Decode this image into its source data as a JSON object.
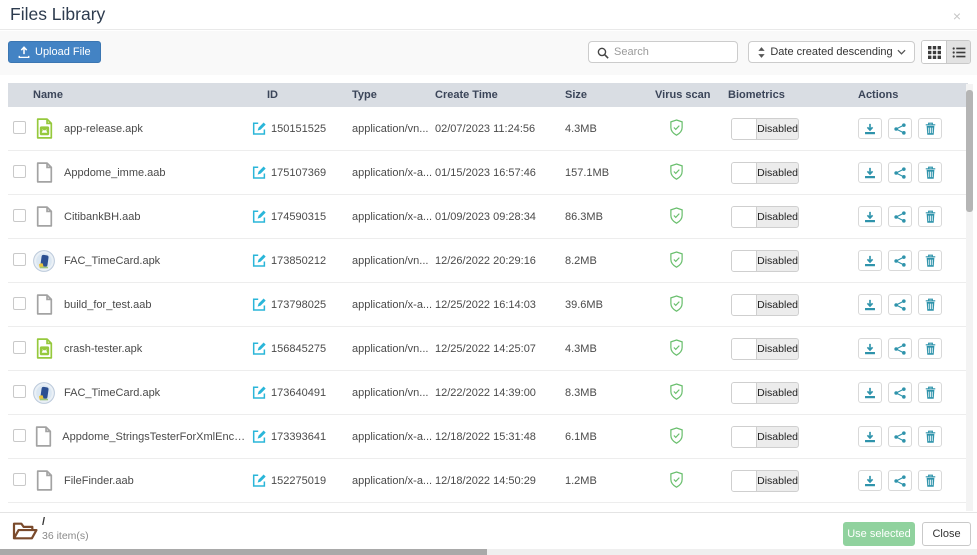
{
  "modal": {
    "title": "Files Library",
    "close_icon": "×"
  },
  "toolbar": {
    "upload_button": "Upload File",
    "search_placeholder": "Search",
    "sort_dropdown_value": "Date created descending"
  },
  "table": {
    "columns": {
      "name": "Name",
      "id": "ID",
      "type": "Type",
      "create_time": "Create Time",
      "size": "Size",
      "virus_scan": "Virus scan",
      "biometrics": "Biometrics",
      "actions": "Actions"
    },
    "rows": [
      {
        "icon": "android-apk-file-icon",
        "name": "app-release.apk",
        "id": "150151525",
        "type": "application/vn...",
        "created": "02/07/2023 11:24:56",
        "size": "4.3MB",
        "virus_scan": "clean",
        "biometrics": "Disabled"
      },
      {
        "icon": "generic-file-icon",
        "name": "Appdome_imme.aab",
        "id": "175107369",
        "type": "application/x-a...",
        "created": "01/15/2023 16:57:46",
        "size": "157.1MB",
        "virus_scan": "clean",
        "biometrics": "Disabled"
      },
      {
        "icon": "generic-file-icon",
        "name": "CitibankBH.aab",
        "id": "174590315",
        "type": "application/x-a...",
        "created": "01/09/2023 09:28:34",
        "size": "86.3MB",
        "virus_scan": "clean",
        "biometrics": "Disabled"
      },
      {
        "icon": "app-logo-icon",
        "name": "FAC_TimeCard.apk",
        "id": "173850212",
        "type": "application/vn...",
        "created": "12/26/2022 20:29:16",
        "size": "8.2MB",
        "virus_scan": "clean",
        "biometrics": "Disabled"
      },
      {
        "icon": "generic-file-icon",
        "name": "build_for_test.aab",
        "id": "173798025",
        "type": "application/x-a...",
        "created": "12/25/2022 16:14:03",
        "size": "39.6MB",
        "virus_scan": "clean",
        "biometrics": "Disabled"
      },
      {
        "icon": "android-apk-file-icon",
        "name": "crash-tester.apk",
        "id": "156845275",
        "type": "application/vn...",
        "created": "12/25/2022 14:25:07",
        "size": "4.3MB",
        "virus_scan": "clean",
        "biometrics": "Disabled"
      },
      {
        "icon": "app-logo-icon",
        "name": "FAC_TimeCard.apk",
        "id": "173640491",
        "type": "application/vn...",
        "created": "12/22/2022 14:39:00",
        "size": "8.3MB",
        "virus_scan": "clean",
        "biometrics": "Disabled"
      },
      {
        "icon": "generic-file-icon",
        "name": "Appdome_StringsTesterForXmlEncrypt...",
        "id": "173393641",
        "type": "application/x-a...",
        "created": "12/18/2022 15:31:48",
        "size": "6.1MB",
        "virus_scan": "clean",
        "biometrics": "Disabled"
      },
      {
        "icon": "generic-file-icon",
        "name": "FileFinder.aab",
        "id": "152275019",
        "type": "application/x-a...",
        "created": "12/18/2022 14:50:29",
        "size": "1.2MB",
        "virus_scan": "clean",
        "biometrics": "Disabled"
      }
    ]
  },
  "footer": {
    "current_path": "/",
    "item_count": "36 item(s)",
    "use_selected_button": "Use selected",
    "close_button": "Close"
  },
  "colors": {
    "primary_blue": "#4383c4",
    "action_teal": "#2e93ab",
    "edit_cyan": "#2ab6d9",
    "virus_green": "#6abf6e",
    "apk_green": "#96c93d",
    "use_selected_green": "#90d29e",
    "table_header_bg": "#d9dde3"
  }
}
